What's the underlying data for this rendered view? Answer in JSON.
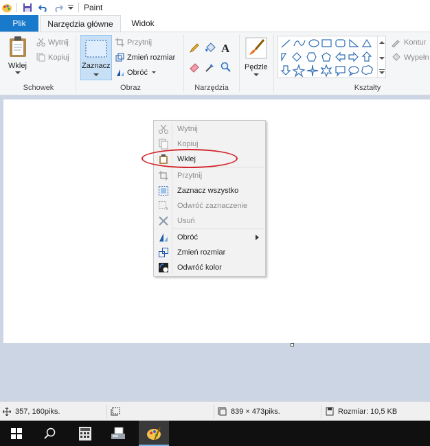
{
  "window": {
    "title": "Paint"
  },
  "tabs": {
    "file": "Plik",
    "home": "Narzędzia główne",
    "view": "Widok"
  },
  "ribbon": {
    "clipboard": {
      "group_label": "Schowek",
      "paste": "Wklej",
      "cut": "Wytnij",
      "copy": "Kopiuj"
    },
    "image": {
      "group_label": "Obraz",
      "select": "Zaznacz",
      "crop": "Przytnij",
      "resize": "Zmień rozmiar",
      "rotate": "Obróć"
    },
    "tools": {
      "group_label": "Narzędzia"
    },
    "brushes": {
      "label": "Pędzle"
    },
    "shapes": {
      "group_label": "Kształty",
      "outline": "Kontur",
      "fill": "Wypełn"
    }
  },
  "context_menu": {
    "items": [
      {
        "label": "Wytnij",
        "enabled": false,
        "icon": "scissors-icon"
      },
      {
        "label": "Kopiuj",
        "enabled": false,
        "icon": "copy-icon"
      },
      {
        "label": "Wklej",
        "enabled": true,
        "icon": "clipboard-icon"
      },
      {
        "label": "Przytnij",
        "enabled": false,
        "icon": "crop-icon"
      },
      {
        "label": "Zaznacz wszystko",
        "enabled": true,
        "icon": "select-all-icon"
      },
      {
        "label": "Odwróć zaznaczenie",
        "enabled": false,
        "icon": "invert-selection-icon"
      },
      {
        "label": "Usuń",
        "enabled": false,
        "icon": "delete-icon"
      },
      {
        "label": "Obróć",
        "enabled": true,
        "icon": "rotate-icon",
        "submenu": true
      },
      {
        "label": "Zmień rozmiar",
        "enabled": true,
        "icon": "resize-icon"
      },
      {
        "label": "Odwróć kolor",
        "enabled": true,
        "icon": "invert-color-icon"
      }
    ]
  },
  "statusbar": {
    "cursor_position": "357, 160piks.",
    "image_size": "839 × 473piks.",
    "file_size": "Rozmiar: 10,5 KB"
  },
  "colors": {
    "accent": "#1979ca",
    "highlight_oval": "#d2232a",
    "taskbar": "#101010"
  }
}
